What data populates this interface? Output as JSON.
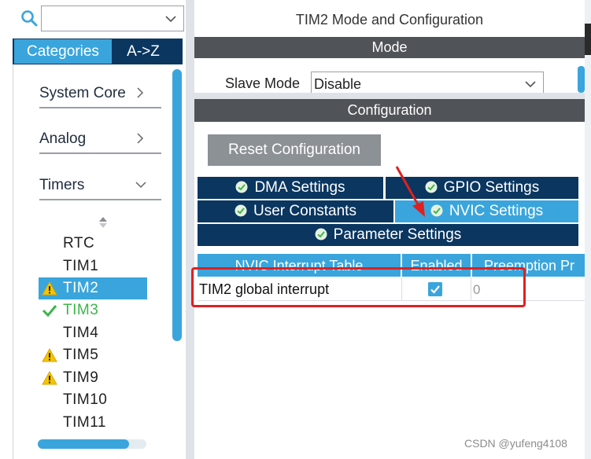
{
  "left_panel": {
    "search": {
      "value": ""
    },
    "tabs": {
      "categories": "Categories",
      "az": "A->Z"
    },
    "categories": [
      {
        "label": "System Core",
        "expanded": false
      },
      {
        "label": "Analog",
        "expanded": false
      },
      {
        "label": "Timers",
        "expanded": true
      }
    ],
    "timers": [
      {
        "label": "RTC",
        "status": "none"
      },
      {
        "label": "TIM1",
        "status": "none"
      },
      {
        "label": "TIM2",
        "status": "warning",
        "selected": true
      },
      {
        "label": "TIM3",
        "status": "ok"
      },
      {
        "label": "TIM4",
        "status": "none"
      },
      {
        "label": "TIM5",
        "status": "warning"
      },
      {
        "label": "TIM9",
        "status": "warning"
      },
      {
        "label": "TIM10",
        "status": "none"
      },
      {
        "label": "TIM11",
        "status": "none"
      }
    ]
  },
  "right_panel": {
    "title": "TIM2 Mode and Configuration",
    "mode_header": "Mode",
    "slave_mode": {
      "label": "Slave Mode",
      "value": "Disable"
    },
    "config_header": "Configuration",
    "reset_button": "Reset Configuration",
    "tabs": {
      "dma": "DMA Settings",
      "gpio": "GPIO Settings",
      "user_constants": "User Constants",
      "nvic": "NVIC Settings",
      "parameter": "Parameter Settings"
    },
    "active_tab": "NVIC Settings",
    "table": {
      "columns": [
        "NVIC Interrupt Table",
        "Enabled",
        "Preemption Pr"
      ],
      "rows": [
        {
          "name": "TIM2 global interrupt",
          "enabled": true,
          "preemption": "0"
        }
      ]
    }
  },
  "watermark": "CSDN @yufeng4108",
  "colors": {
    "accent": "#3aa5dc",
    "navy": "#0a3660",
    "header_gray": "#505357",
    "button_gray": "#8c9196",
    "warning": "#f5c400",
    "ok_green": "#3cb54a",
    "annotation_red": "#e02020"
  }
}
